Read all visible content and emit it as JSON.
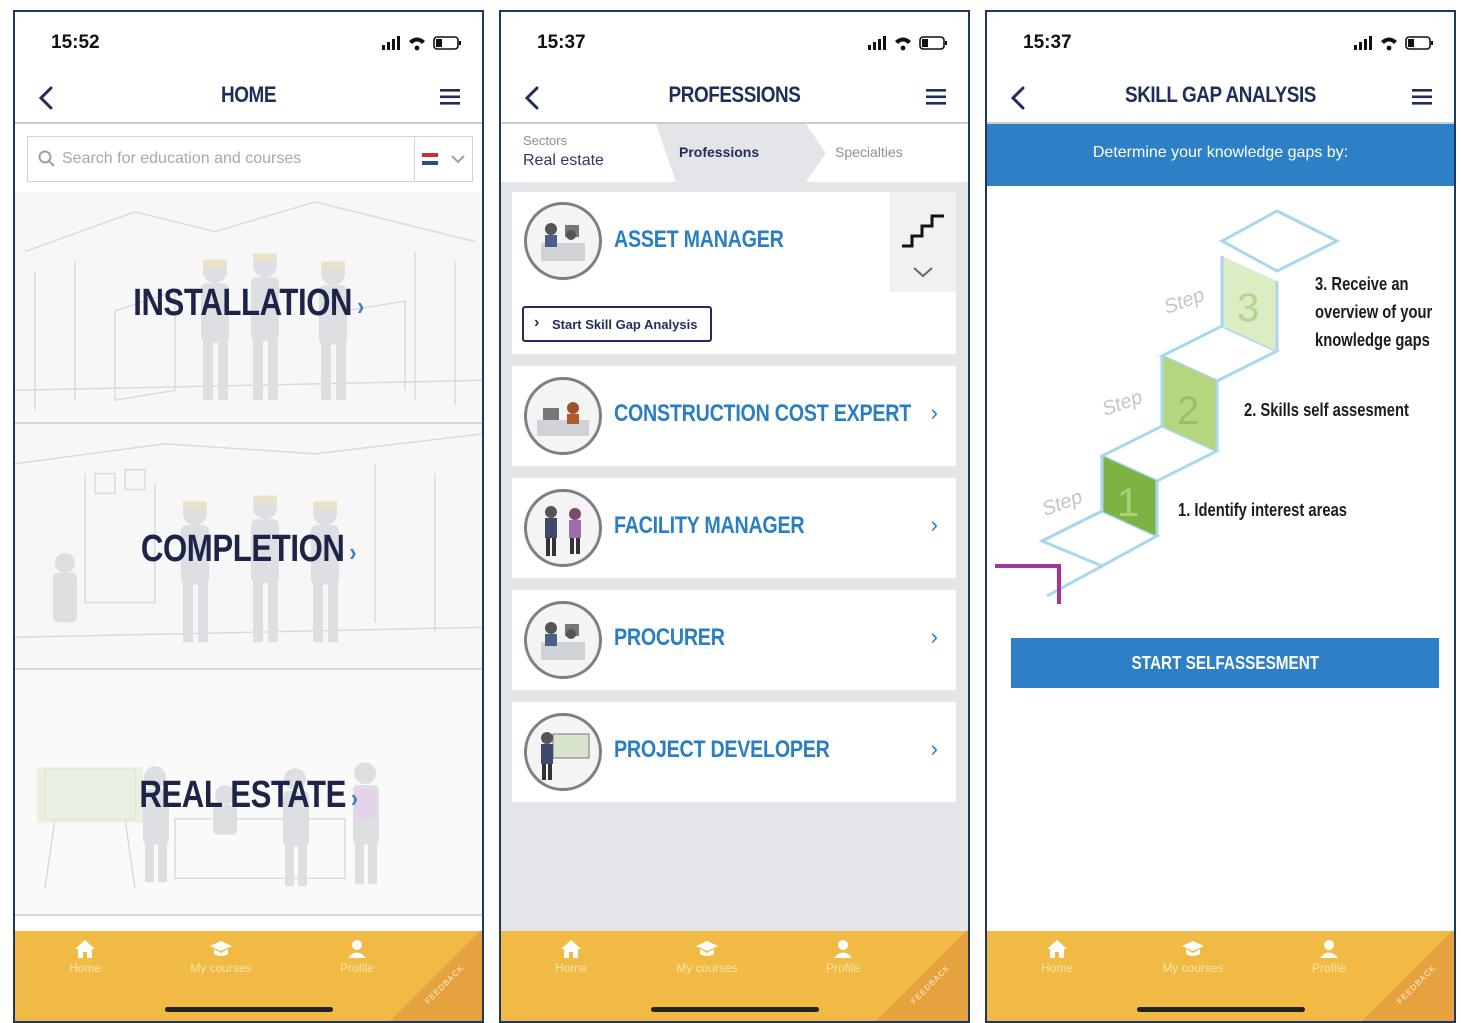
{
  "colors": {
    "navy": "#1f2d5a",
    "blue": "#2a7fc3",
    "banner_blue": "#2d7fc6",
    "tabbar": "#f0ba45",
    "step_green": "#7cb342"
  },
  "tabbar": {
    "home": "Home",
    "courses": "My courses",
    "profile": "Profile",
    "feedback": "FEEDBACK"
  },
  "screen1": {
    "time": "15:52",
    "title": "HOME",
    "search_placeholder": "Search for education and courses",
    "sectors": [
      {
        "label": "INSTALLATION"
      },
      {
        "label": "COMPLETION"
      },
      {
        "label": "REAL ESTATE"
      }
    ]
  },
  "screen2": {
    "time": "15:37",
    "title": "PROFESSIONS",
    "breadcrumb": {
      "sectors_caption": "Sectors",
      "sectors_value": "Real estate",
      "professions": "Professions",
      "specialties": "Specialties"
    },
    "skill_button": "Start Skill Gap Analysis",
    "professions": [
      {
        "name": "ASSET MANAGER"
      },
      {
        "name": "CONSTRUCTION COST EXPERT"
      },
      {
        "name": "FACILITY MANAGER"
      },
      {
        "name": "PROCURER"
      },
      {
        "name": "PROJECT DEVELOPER"
      }
    ]
  },
  "screen3": {
    "time": "15:37",
    "title": "SKILL GAP ANALYSIS",
    "banner": "Determine your knowledge gaps by:",
    "step_word": "Step",
    "steps": [
      {
        "num": "1",
        "label": "1. Identify interest areas"
      },
      {
        "num": "2",
        "label": "2. Skills self assesment"
      },
      {
        "num": "3",
        "label_lines": [
          "3. Receive an",
          "overview of your",
          "knowledge gaps"
        ]
      }
    ],
    "cta": "START SELFASSESMENT"
  }
}
